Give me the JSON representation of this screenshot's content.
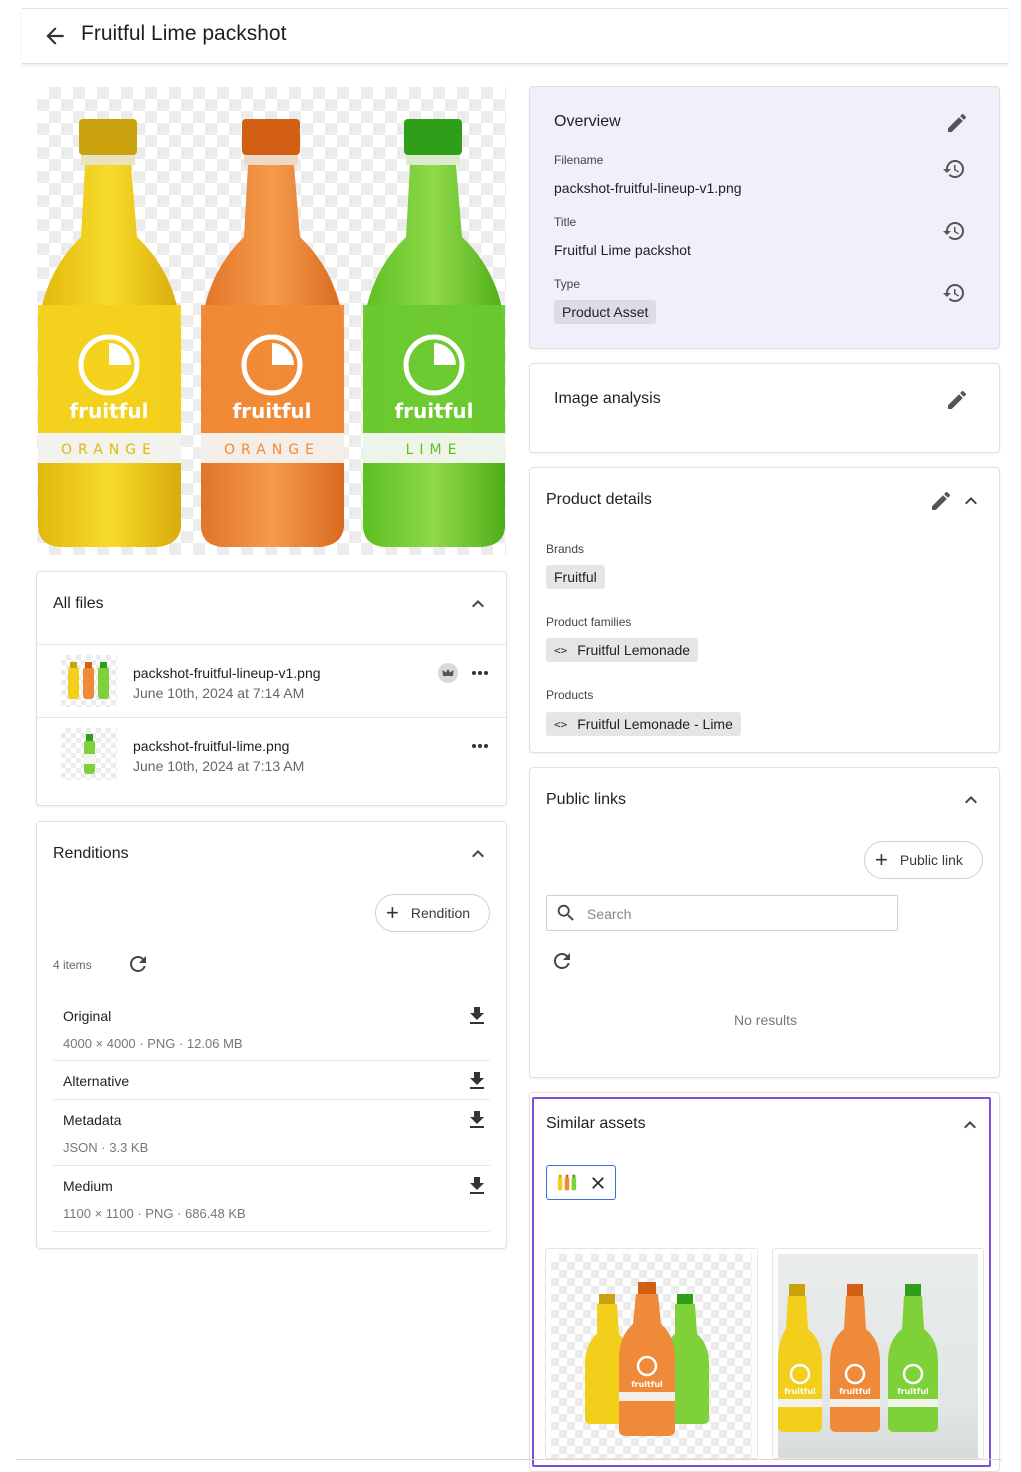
{
  "header": {
    "title": "Fruitful Lime packshot"
  },
  "preview": {
    "bottles": [
      {
        "brand": "fruitful",
        "flavor": "ORANGE",
        "liquid": "#f2cf1a",
        "cap": "#c9a20e"
      },
      {
        "brand": "fruitful",
        "flavor": "ORANGE",
        "liquid": "#ef8a3a",
        "cap": "#d35f12"
      },
      {
        "brand": "fruitful",
        "flavor": "LIME",
        "liquid": "#7fd13a",
        "cap": "#2f9f1a"
      }
    ]
  },
  "all_files": {
    "title": "All files",
    "files": [
      {
        "name": "packshot-fruitful-lineup-v1.png",
        "date": "June 10th, 2024 at 7:14 AM",
        "primary": true
      },
      {
        "name": "packshot-fruitful-lime.png",
        "date": "June 10th, 2024 at 7:13 AM",
        "primary": false
      }
    ]
  },
  "renditions": {
    "title": "Renditions",
    "add_label": "Rendition",
    "count_label": "4 items",
    "items": [
      {
        "name": "Original",
        "meta": "4000 × 4000 · PNG · 12.06 MB"
      },
      {
        "name": "Alternative",
        "meta": ""
      },
      {
        "name": "Metadata",
        "meta": "JSON · 3.3 KB"
      },
      {
        "name": "Medium",
        "meta": "1100 × 1100 · PNG · 686.48 KB"
      }
    ]
  },
  "overview": {
    "title": "Overview",
    "filename_label": "Filename",
    "filename_value": "packshot-fruitful-lineup-v1.png",
    "title_label": "Title",
    "title_value": "Fruitful Lime packshot",
    "type_label": "Type",
    "type_value": "Product Asset",
    "bg_color": "#f0f0fb"
  },
  "image_analysis": {
    "title": "Image analysis"
  },
  "product_details": {
    "title": "Product details",
    "brands_label": "Brands",
    "brands_value": "Fruitful",
    "families_label": "Product families",
    "families_value": "Fruitful Lemonade",
    "products_label": "Products",
    "products_value": "Fruitful Lemonade - Lime",
    "code_glyph": "<>"
  },
  "public_links": {
    "title": "Public links",
    "add_label": "Public link",
    "search_placeholder": "Search",
    "empty_label": "No results"
  },
  "similar_assets": {
    "title": "Similar assets",
    "highlight_color": "#7b4fd6",
    "filter_chip_color": "#3b6fd8"
  }
}
